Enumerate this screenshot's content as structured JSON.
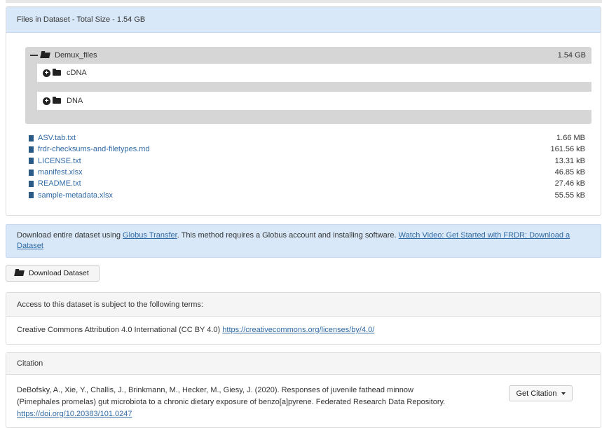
{
  "files_panel": {
    "heading": "Files in Dataset  - Total Size - 1.54 GB",
    "root_folder": {
      "name": "Demux_files",
      "size": "1.54 GB"
    },
    "sub_folders": [
      {
        "name": "cDNA"
      },
      {
        "name": "DNA"
      }
    ],
    "files": [
      {
        "name": "ASV.tab.txt",
        "size": "1.66 MB"
      },
      {
        "name": "frdr-checksums-and-filetypes.md",
        "size": "161.56 kB"
      },
      {
        "name": "LICENSE.txt",
        "size": "13.31 kB"
      },
      {
        "name": "manifest.xlsx",
        "size": "46.85 kB"
      },
      {
        "name": "README.txt",
        "size": "27.46 kB"
      },
      {
        "name": "sample-metadata.xlsx",
        "size": "55.55 kB"
      }
    ]
  },
  "globus": {
    "prefix": "Download entire dataset using ",
    "link_text": "Globus Transfer",
    "middle": ". This method requires a Globus account and installing software. ",
    "video_link_text": "Watch Video: Get Started with FRDR: Download a Dataset"
  },
  "download_button": {
    "label": "Download Dataset"
  },
  "terms": {
    "heading": "Access to this dataset is subject to the following terms:",
    "license_text": "Creative Commons Attribution 4.0 International (CC BY 4.0) ",
    "license_link": "https://creativecommons.org/licenses/by/4.0/"
  },
  "citation": {
    "heading": "Citation",
    "line1": "DeBofsky, A., Xie, Y., Challis, J., Brinkmann, M., Hecker, M., Giesy, J. (2020). Responses of juvenile fathead minnow",
    "line2": "(Pimephales promelas) gut microbiota to a chronic dietary exposure of benzo[a]pyrene. Federated Research Data Repository.",
    "doi": "https://doi.org/10.20383/101.0247",
    "button_label": "Get Citation"
  }
}
